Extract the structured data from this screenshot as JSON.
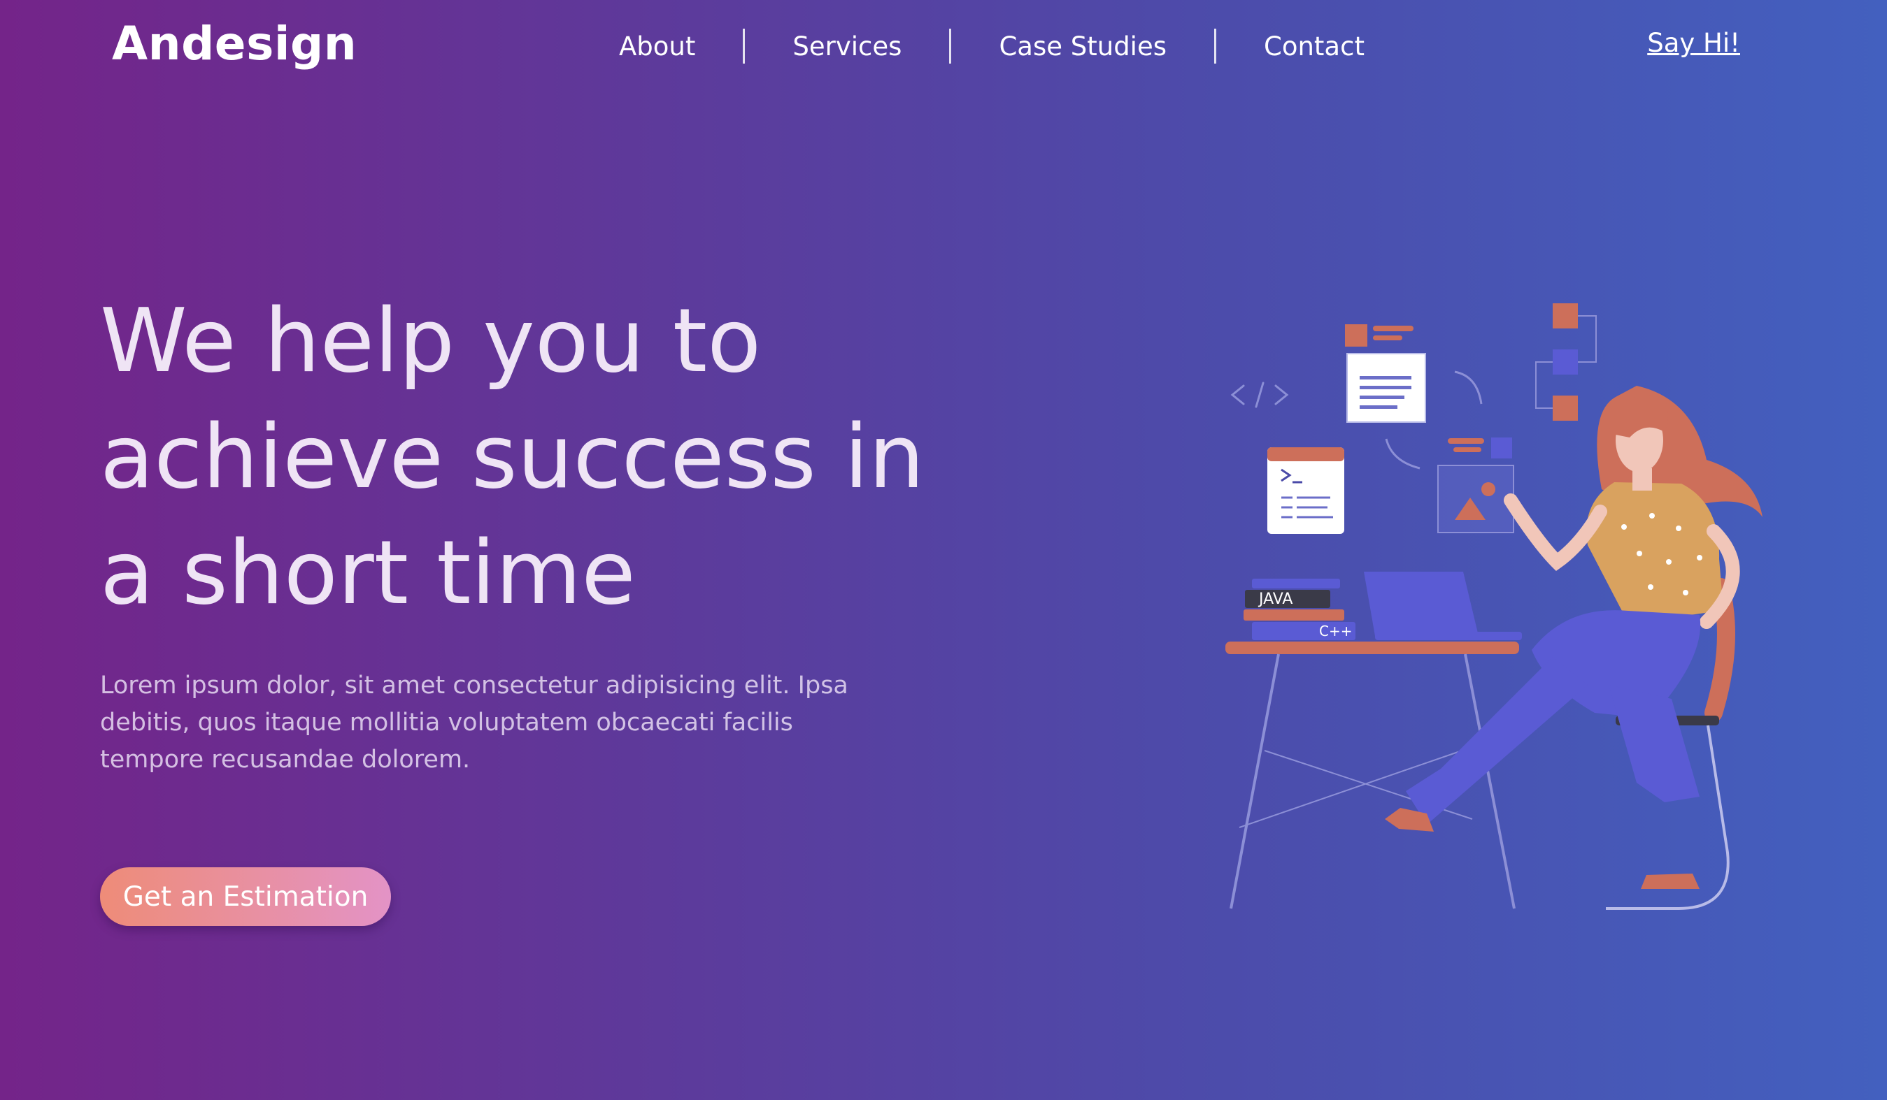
{
  "header": {
    "logo": "Andesign",
    "nav": [
      "About",
      "Services",
      "Case Studies",
      "Contact"
    ],
    "say_hi": "Say Hi!"
  },
  "hero": {
    "headline_lines": [
      "We help you to",
      "achieve success in",
      "a short time"
    ],
    "lead": "Lorem ipsum dolor, sit amet consectetur adipisicing elit. Ipsa debitis, quos itaque mollitia voluptatem obcaecati facilis tempore recusandae dolorem.",
    "cta_label": "Get an Estimation"
  },
  "illustration": {
    "book_labels": [
      "JAVA",
      "C++"
    ]
  },
  "colors": {
    "gradient_start": "#742489",
    "gradient_end": "#4360bf",
    "cta_start": "#ee8c78",
    "cta_end": "#e393c6",
    "accent_orange": "#cd6f5a",
    "accent_indigo": "#5a5bd4"
  }
}
